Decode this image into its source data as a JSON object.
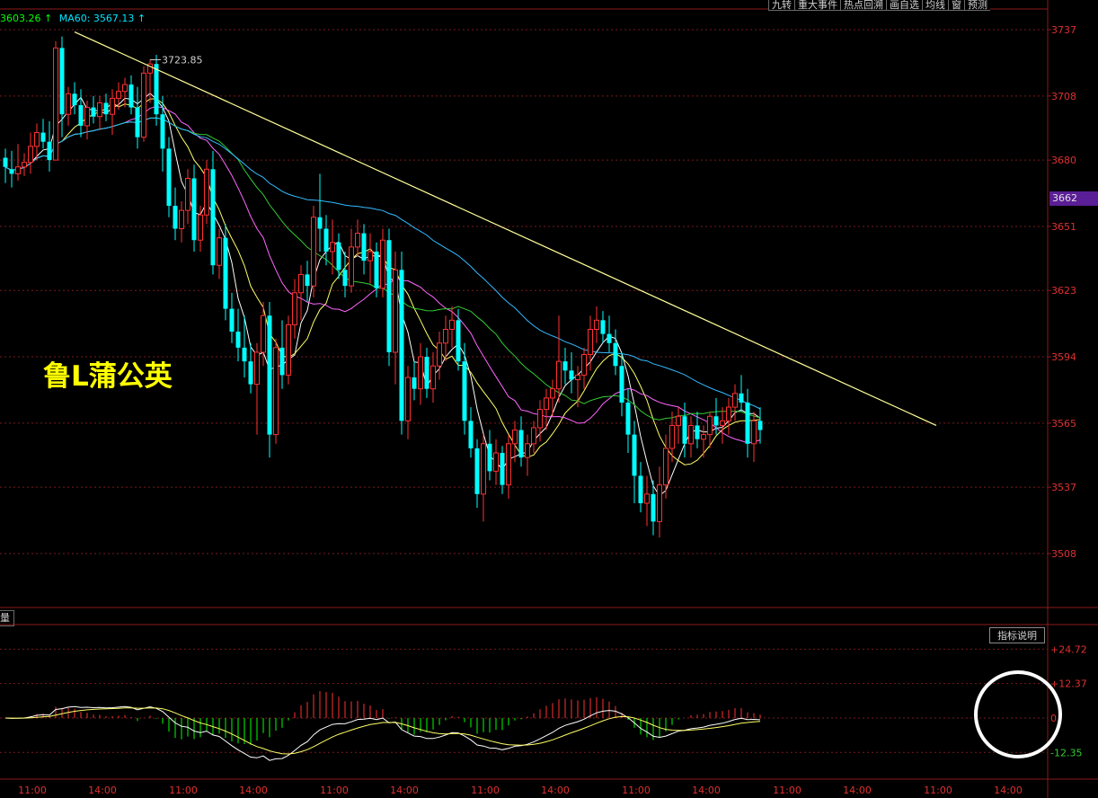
{
  "toolbar": [
    "九转",
    "重大事件",
    "热点回溯",
    "画自选",
    "均线",
    "窗",
    "预测"
  ],
  "legend": [
    {
      "text": "3603.26 ↑",
      "color": "#00ff00"
    },
    {
      "text": "MA60: 3567.13 ↑",
      "color": "#00e5ff"
    }
  ],
  "overlay_text": "鲁L蒲公英",
  "sub_tab": "量",
  "indicator_button": "指标说明",
  "current_price": "3662",
  "colors": {
    "up": "#ff3232",
    "down": "#00ffff",
    "background": "#000000"
  },
  "chart_data": [
    {
      "type": "candlestick",
      "panel": "price",
      "y_ticks": [
        3737,
        3708,
        3680,
        3651,
        3623,
        3594,
        3565,
        3537,
        3508
      ],
      "ylim": [
        3478,
        3746
      ],
      "x_tick_labels": [
        "11:00",
        "14:00",
        "11:00",
        "14:00",
        "11:00",
        "14:00",
        "11:00",
        "14:00",
        "11:00",
        "14:00",
        "11:00",
        "14:00",
        "11:00",
        "14:00"
      ],
      "annotations": [
        {
          "text": "3723.85",
          "bar": 23,
          "value": 3723.85
        }
      ],
      "trendline": {
        "from": [
          11,
          3736
        ],
        "to": [
          148,
          3564
        ]
      },
      "candles": [
        [
          3681,
          3685,
          3670,
          3677
        ],
        [
          3676,
          3684,
          3668,
          3674
        ],
        [
          3674,
          3687,
          3671,
          3677
        ],
        [
          3677,
          3683,
          3673,
          3679
        ],
        [
          3679,
          3692,
          3674,
          3686
        ],
        [
          3686,
          3696,
          3680,
          3692
        ],
        [
          3692,
          3698,
          3685,
          3688
        ],
        [
          3688,
          3697,
          3675,
          3680
        ],
        [
          3680,
          3732,
          3680,
          3729
        ],
        [
          3729,
          3734,
          3690,
          3700
        ],
        [
          3700,
          3712,
          3695,
          3709
        ],
        [
          3709,
          3714,
          3700,
          3704
        ],
        [
          3704,
          3711,
          3690,
          3695
        ],
        [
          3695,
          3706,
          3689,
          3703
        ],
        [
          3703,
          3708,
          3696,
          3699
        ],
        [
          3699,
          3708,
          3693,
          3705
        ],
        [
          3705,
          3709,
          3697,
          3700
        ],
        [
          3700,
          3711,
          3691,
          3707
        ],
        [
          3707,
          3714,
          3702,
          3710
        ],
        [
          3710,
          3716,
          3703,
          3713
        ],
        [
          3713,
          3717,
          3700,
          3703
        ],
        [
          3703,
          3712,
          3685,
          3690
        ],
        [
          3690,
          3721,
          3688,
          3718
        ],
        [
          3718,
          3724,
          3705,
          3722
        ],
        [
          3722,
          3726,
          3695,
          3700
        ],
        [
          3700,
          3708,
          3675,
          3685
        ],
        [
          3685,
          3690,
          3655,
          3660
        ],
        [
          3660,
          3668,
          3645,
          3650
        ],
        [
          3650,
          3662,
          3644,
          3658
        ],
        [
          3658,
          3676,
          3652,
          3672
        ],
        [
          3672,
          3678,
          3640,
          3645
        ],
        [
          3645,
          3660,
          3640,
          3656
        ],
        [
          3656,
          3680,
          3652,
          3676
        ],
        [
          3676,
          3684,
          3630,
          3634
        ],
        [
          3634,
          3650,
          3628,
          3646
        ],
        [
          3646,
          3652,
          3610,
          3615
        ],
        [
          3615,
          3622,
          3600,
          3605
        ],
        [
          3605,
          3615,
          3592,
          3598
        ],
        [
          3598,
          3612,
          3585,
          3592
        ],
        [
          3592,
          3600,
          3578,
          3582
        ],
        [
          3582,
          3600,
          3560,
          3596
        ],
        [
          3596,
          3618,
          3590,
          3612
        ],
        [
          3612,
          3618,
          3550,
          3560
        ],
        [
          3560,
          3602,
          3556,
          3598
        ],
        [
          3598,
          3610,
          3580,
          3586
        ],
        [
          3586,
          3612,
          3582,
          3608
        ],
        [
          3608,
          3628,
          3602,
          3622
        ],
        [
          3622,
          3634,
          3610,
          3630
        ],
        [
          3630,
          3636,
          3618,
          3625
        ],
        [
          3625,
          3660,
          3620,
          3655
        ],
        [
          3655,
          3674,
          3640,
          3650
        ],
        [
          3650,
          3656,
          3634,
          3640
        ],
        [
          3640,
          3654,
          3630,
          3644
        ],
        [
          3644,
          3648,
          3628,
          3632
        ],
        [
          3632,
          3640,
          3620,
          3625
        ],
        [
          3625,
          3650,
          3622,
          3642
        ],
        [
          3642,
          3654,
          3638,
          3648
        ],
        [
          3648,
          3652,
          3630,
          3636
        ],
        [
          3636,
          3648,
          3626,
          3640
        ],
        [
          3640,
          3644,
          3620,
          3624
        ],
        [
          3624,
          3650,
          3620,
          3645
        ],
        [
          3645,
          3650,
          3590,
          3596
        ],
        [
          3596,
          3640,
          3582,
          3632
        ],
        [
          3632,
          3640,
          3560,
          3566
        ],
        [
          3566,
          3590,
          3558,
          3585
        ],
        [
          3585,
          3592,
          3575,
          3580
        ],
        [
          3580,
          3600,
          3573,
          3594
        ],
        [
          3594,
          3598,
          3576,
          3580
        ],
        [
          3580,
          3596,
          3574,
          3590
        ],
        [
          3590,
          3605,
          3584,
          3600
        ],
        [
          3600,
          3612,
          3592,
          3606
        ],
        [
          3606,
          3616,
          3598,
          3610
        ],
        [
          3610,
          3615,
          3588,
          3592
        ],
        [
          3592,
          3600,
          3560,
          3566
        ],
        [
          3566,
          3572,
          3550,
          3554
        ],
        [
          3554,
          3558,
          3528,
          3534
        ],
        [
          3534,
          3560,
          3522,
          3556
        ],
        [
          3556,
          3562,
          3540,
          3544
        ],
        [
          3544,
          3558,
          3538,
          3552
        ],
        [
          3552,
          3555,
          3534,
          3538
        ],
        [
          3538,
          3560,
          3532,
          3556
        ],
        [
          3556,
          3566,
          3548,
          3562
        ],
        [
          3562,
          3568,
          3546,
          3550
        ],
        [
          3550,
          3560,
          3542,
          3556
        ],
        [
          3556,
          3566,
          3552,
          3563
        ],
        [
          3563,
          3575,
          3557,
          3571
        ],
        [
          3571,
          3580,
          3562,
          3576
        ],
        [
          3576,
          3584,
          3568,
          3580
        ],
        [
          3580,
          3612,
          3574,
          3592
        ],
        [
          3592,
          3598,
          3582,
          3588
        ],
        [
          3588,
          3596,
          3578,
          3584
        ],
        [
          3584,
          3590,
          3572,
          3586
        ],
        [
          3586,
          3598,
          3580,
          3595
        ],
        [
          3595,
          3612,
          3588,
          3606
        ],
        [
          3606,
          3616,
          3600,
          3610
        ],
        [
          3610,
          3614,
          3600,
          3604
        ],
        [
          3604,
          3612,
          3596,
          3600
        ],
        [
          3600,
          3606,
          3586,
          3590
        ],
        [
          3590,
          3596,
          3568,
          3574
        ],
        [
          3574,
          3580,
          3552,
          3560
        ],
        [
          3560,
          3566,
          3530,
          3542
        ],
        [
          3542,
          3548,
          3526,
          3530
        ],
        [
          3530,
          3542,
          3520,
          3534
        ],
        [
          3534,
          3540,
          3516,
          3522
        ],
        [
          3522,
          3546,
          3515,
          3538
        ],
        [
          3538,
          3560,
          3532,
          3554
        ],
        [
          3554,
          3570,
          3548,
          3564
        ],
        [
          3564,
          3572,
          3556,
          3568
        ],
        [
          3568,
          3574,
          3550,
          3556
        ],
        [
          3556,
          3568,
          3550,
          3564
        ],
        [
          3564,
          3570,
          3554,
          3558
        ],
        [
          3558,
          3564,
          3550,
          3560
        ],
        [
          3560,
          3570,
          3554,
          3568
        ],
        [
          3568,
          3576,
          3560,
          3564
        ],
        [
          3564,
          3572,
          3556,
          3566
        ],
        [
          3566,
          3576,
          3560,
          3572
        ],
        [
          3572,
          3582,
          3566,
          3578
        ],
        [
          3578,
          3586,
          3570,
          3574
        ],
        [
          3574,
          3580,
          3550,
          3556
        ],
        [
          3556,
          3570,
          3548,
          3566
        ],
        [
          3566,
          3572,
          3556,
          3562
        ]
      ]
    },
    {
      "type": "bar",
      "panel": "oscillator",
      "y_ticks": [
        "+24.72",
        "+12.37",
        "0",
        "-12.35"
      ],
      "ylim": [
        -20,
        30
      ],
      "series_colors": {
        "positive": "#ff3232",
        "negative": "#00ff00",
        "line1": "#ffffff",
        "line2": "#ffff66"
      }
    }
  ]
}
